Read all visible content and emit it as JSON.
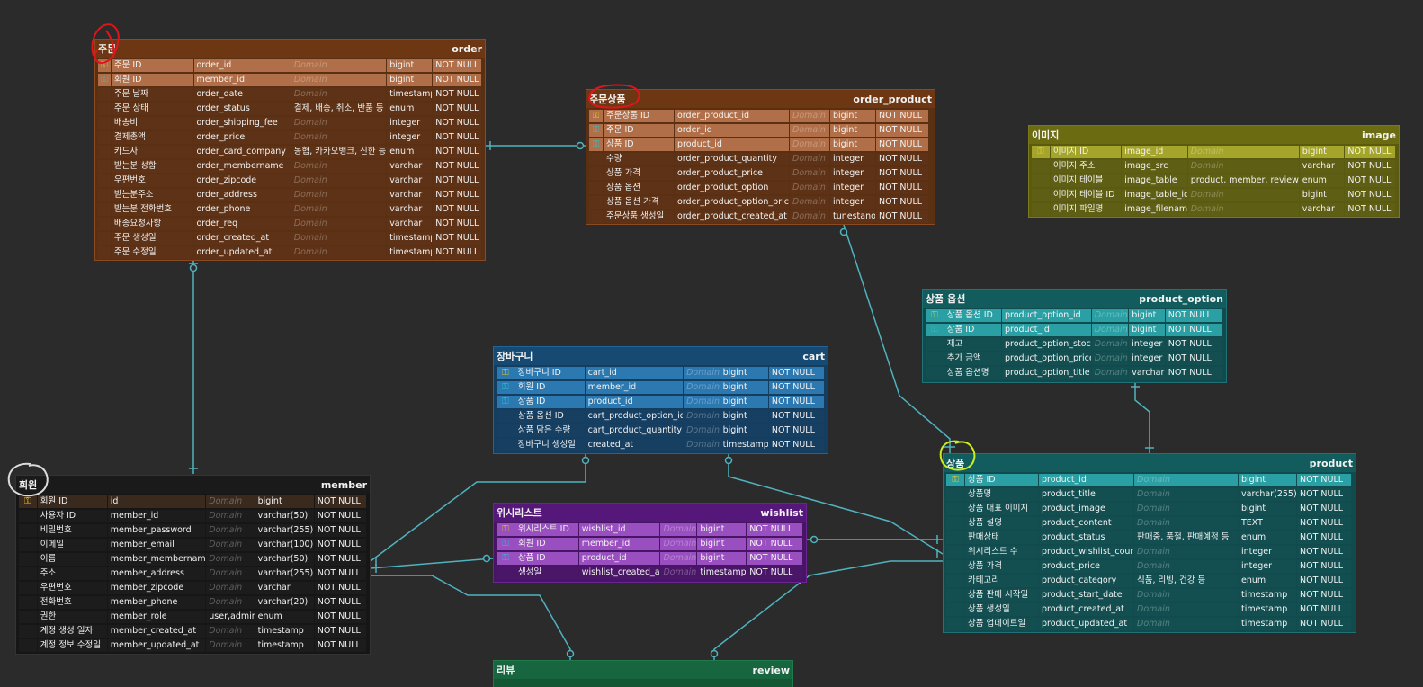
{
  "entities": {
    "order": {
      "korean": "주문",
      "english": "order",
      "colors": {
        "header": "#6d3714",
        "body": "#5b2f12",
        "key": "#b06f48",
        "cell": "#5e3216",
        "border": "#8a4a22"
      },
      "rows": [
        {
          "key": "pk",
          "logical": "주문 ID",
          "physical": "order_id",
          "domain": "Domain",
          "type": "bigint",
          "nn": "NOT NULL"
        },
        {
          "key": "fk",
          "logical": "회원 ID",
          "physical": "member_id",
          "domain": "Domain",
          "type": "bigint",
          "nn": "NOT NULL"
        },
        {
          "key": "",
          "logical": "주문 날짜",
          "physical": "order_date",
          "domain": "Domain",
          "type": "timestamp",
          "nn": "NOT NULL"
        },
        {
          "key": "",
          "logical": "주문 상태",
          "physical": "order_status",
          "domain": "결제, 배송, 취소, 반품 등",
          "type": "enum",
          "nn": "NOT NULL"
        },
        {
          "key": "",
          "logical": "배송비",
          "physical": "order_shipping_fee",
          "domain": "Domain",
          "type": "integer",
          "nn": "NOT NULL"
        },
        {
          "key": "",
          "logical": "결제총액",
          "physical": "order_price",
          "domain": "Domain",
          "type": "integer",
          "nn": "NOT NULL"
        },
        {
          "key": "",
          "logical": "카드사",
          "physical": "order_card_company",
          "domain": "농협, 카카오뱅크, 신한 등",
          "type": "enum",
          "nn": "NOT NULL"
        },
        {
          "key": "",
          "logical": "받는분 성함",
          "physical": "order_membername",
          "domain": "Domain",
          "type": "varchar",
          "nn": "NOT NULL"
        },
        {
          "key": "",
          "logical": "우편번호",
          "physical": "order_zipcode",
          "domain": "Domain",
          "type": "varchar",
          "nn": "NOT NULL"
        },
        {
          "key": "",
          "logical": "받는분주소",
          "physical": "order_address",
          "domain": "Domain",
          "type": "varchar",
          "nn": "NOT NULL"
        },
        {
          "key": "",
          "logical": "받는분 전화번호",
          "physical": "order_phone",
          "domain": "Domain",
          "type": "varchar",
          "nn": "NOT NULL"
        },
        {
          "key": "",
          "logical": "배송요청사항",
          "physical": "order_req",
          "domain": "Domain",
          "type": "varchar",
          "nn": "NOT NULL"
        },
        {
          "key": "",
          "logical": "주문 생성일",
          "physical": "order_created_at",
          "domain": "Domain",
          "type": "timestamp",
          "nn": "NOT NULL"
        },
        {
          "key": "",
          "logical": "주문 수정일",
          "physical": "order_updated_at",
          "domain": "Domain",
          "type": "timestamp",
          "nn": "NOT NULL"
        }
      ]
    },
    "order_product": {
      "korean": "주문상품",
      "english": "order_product",
      "colors": {
        "header": "#6d3714",
        "body": "#5b2f12",
        "key": "#b06f48",
        "cell": "#5e3216",
        "border": "#8a4a22"
      },
      "rows": [
        {
          "key": "pk",
          "logical": "주문상품 ID",
          "physical": "order_product_id",
          "domain": "Domain",
          "type": "bigint",
          "nn": "NOT NULL"
        },
        {
          "key": "fk",
          "logical": "주문 ID",
          "physical": "order_id",
          "domain": "Domain",
          "type": "bigint",
          "nn": "NOT NULL"
        },
        {
          "key": "fk",
          "logical": "상품 ID",
          "physical": "product_id",
          "domain": "Domain",
          "type": "bigint",
          "nn": "NOT NULL"
        },
        {
          "key": "",
          "logical": "수량",
          "physical": "order_product_quantity",
          "domain": "Domain",
          "type": "integer",
          "nn": "NOT NULL"
        },
        {
          "key": "",
          "logical": "상품 가격",
          "physical": "order_product_price",
          "domain": "Domain",
          "type": "integer",
          "nn": "NOT NULL"
        },
        {
          "key": "",
          "logical": "상품 옵션",
          "physical": "order_product_option",
          "domain": "Domain",
          "type": "integer",
          "nn": "NOT NULL"
        },
        {
          "key": "",
          "logical": "상품 옵션 가격",
          "physical": "order_product_option_price",
          "domain": "Domain",
          "type": "integer",
          "nn": "NOT NULL"
        },
        {
          "key": "",
          "logical": "주문상품 생성일",
          "physical": "order_product_created_at",
          "domain": "Domain",
          "type": "tunestano",
          "nn": "NOT NULL"
        }
      ]
    },
    "image": {
      "korean": "이미지",
      "english": "image",
      "colors": {
        "header": "#6b6b12",
        "body": "#5a5a10",
        "key": "#a5a52c",
        "cell": "#5e5e14",
        "border": "#7a7a1a"
      },
      "rows": [
        {
          "key": "pk",
          "logical": "이미지 ID",
          "physical": "image_id",
          "domain": "Domain",
          "type": "bigint",
          "nn": "NOT NULL"
        },
        {
          "key": "",
          "logical": "이미지 주소",
          "physical": "image_src",
          "domain": "Domain",
          "type": "varchar",
          "nn": "NOT NULL"
        },
        {
          "key": "",
          "logical": "이미지 테이블",
          "physical": "image_table",
          "domain": "product, member, review 등",
          "type": "enum",
          "nn": "NOT NULL"
        },
        {
          "key": "",
          "logical": "이미지 테이블 ID",
          "physical": "image_table_id",
          "domain": "Domain",
          "type": "bigint",
          "nn": "NOT NULL"
        },
        {
          "key": "",
          "logical": "이미지 파일명",
          "physical": "image_filename",
          "domain": "Domain",
          "type": "varchar",
          "nn": "NOT NULL"
        }
      ]
    },
    "product_option": {
      "korean": "상품 옵션",
      "english": "product_option",
      "colors": {
        "header": "#135c5e",
        "body": "#114b4d",
        "key": "#2aa0a4",
        "cell": "#134f51",
        "border": "#1f7275"
      },
      "rows": [
        {
          "key": "pk",
          "logical": "상품 옵션 ID",
          "physical": "product_option_id",
          "domain": "Domain",
          "type": "bigint",
          "nn": "NOT NULL"
        },
        {
          "key": "fk",
          "logical": "상품 ID",
          "physical": "product_id",
          "domain": "Domain",
          "type": "bigint",
          "nn": "NOT NULL"
        },
        {
          "key": "",
          "logical": "재고",
          "physical": "product_option_stock",
          "domain": "Domain",
          "type": "integer",
          "nn": "NOT NULL"
        },
        {
          "key": "",
          "logical": "추가 금액",
          "physical": "product_option_price",
          "domain": "Domain",
          "type": "integer",
          "nn": "NOT NULL"
        },
        {
          "key": "",
          "logical": "상품 옵션명",
          "physical": "product_option_title",
          "domain": "Domain",
          "type": "varchar",
          "nn": "NOT NULL"
        }
      ]
    },
    "cart": {
      "korean": "장바구니",
      "english": "cart",
      "colors": {
        "header": "#174a73",
        "body": "#143e60",
        "key": "#2c79b2",
        "cell": "#163f62",
        "border": "#23639a"
      },
      "rows": [
        {
          "key": "pk",
          "logical": "장바구니 ID",
          "physical": "cart_id",
          "domain": "Domain",
          "type": "bigint",
          "nn": "NOT NULL"
        },
        {
          "key": "fk",
          "logical": "회원 ID",
          "physical": "member_id",
          "domain": "Domain",
          "type": "bigint",
          "nn": "NOT NULL"
        },
        {
          "key": "fk",
          "logical": "상품 ID",
          "physical": "product_id",
          "domain": "Domain",
          "type": "bigint",
          "nn": "NOT NULL"
        },
        {
          "key": "",
          "logical": "상품 옵션 ID",
          "physical": "cart_product_option_id",
          "domain": "Domain",
          "type": "bigint",
          "nn": "NOT NULL"
        },
        {
          "key": "",
          "logical": "상품 담은 수량",
          "physical": "cart_product_quantity",
          "domain": "Domain",
          "type": "bigint",
          "nn": "NOT NULL"
        },
        {
          "key": "",
          "logical": "장바구니 생성일",
          "physical": "created_at",
          "domain": "Domain",
          "type": "timestamp",
          "nn": "NOT NULL"
        }
      ]
    },
    "member": {
      "korean": "회원",
      "english": "member",
      "colors": {
        "header": "#1a1a1a",
        "body": "#161616",
        "key": "#3a2a1e",
        "cell": "#1c1c1c",
        "border": "#333333"
      },
      "rows": [
        {
          "key": "pk",
          "logical": "회원 ID",
          "physical": "id",
          "domain": "Domain",
          "type": "bigint",
          "nn": "NOT NULL"
        },
        {
          "key": "",
          "logical": "사용자 ID",
          "physical": "member_id",
          "domain": "Domain",
          "type": "varchar(50)",
          "nn": "NOT NULL"
        },
        {
          "key": "",
          "logical": "비밀번호",
          "physical": "member_password",
          "domain": "Domain",
          "type": "varchar(255)",
          "nn": "NOT NULL"
        },
        {
          "key": "",
          "logical": "이메일",
          "physical": "member_email",
          "domain": "Domain",
          "type": "varchar(100)",
          "nn": "NOT NULL"
        },
        {
          "key": "",
          "logical": "이름",
          "physical": "member_membername",
          "domain": "Domain",
          "type": "varchar(50)",
          "nn": "NOT NULL"
        },
        {
          "key": "",
          "logical": "주소",
          "physical": "member_address",
          "domain": "Domain",
          "type": "varchar(255)",
          "nn": "NOT NULL"
        },
        {
          "key": "",
          "logical": "우편번호",
          "physical": "member_zipcode",
          "domain": "Domain",
          "type": "varchar",
          "nn": "NOT NULL"
        },
        {
          "key": "",
          "logical": "전화번호",
          "physical": "member_phone",
          "domain": "Domain",
          "type": "varchar(20)",
          "nn": "NOT NULL"
        },
        {
          "key": "",
          "logical": "권한",
          "physical": "member_role",
          "domain": "user,admin",
          "type": "enum",
          "nn": "NOT NULL"
        },
        {
          "key": "",
          "logical": "계정 생성 일자",
          "physical": "member_created_at",
          "domain": "Domain",
          "type": "timestamp",
          "nn": "NOT NULL"
        },
        {
          "key": "",
          "logical": "계정 정보 수정일",
          "physical": "member_updated_at",
          "domain": "Domain",
          "type": "timestamp",
          "nn": "NOT NULL"
        }
      ]
    },
    "wishlist": {
      "korean": "위시리스트",
      "english": "wishlist",
      "colors": {
        "header": "#56177a",
        "body": "#471466",
        "key": "#9a4fc0",
        "cell": "#4a1668",
        "border": "#6b2494"
      },
      "rows": [
        {
          "key": "pk",
          "logical": "위시리스트 ID",
          "physical": "wishlist_id",
          "domain": "Domain",
          "type": "bigint",
          "nn": "NOT NULL"
        },
        {
          "key": "fk",
          "logical": "회원 ID",
          "physical": "member_id",
          "domain": "Domain",
          "type": "bigint",
          "nn": "NOT NULL"
        },
        {
          "key": "fk",
          "logical": "상품 ID",
          "physical": "product_id",
          "domain": "Domain",
          "type": "bigint",
          "nn": "NOT NULL"
        },
        {
          "key": "",
          "logical": "생성일",
          "physical": "wishlist_created_at",
          "domain": "Domain",
          "type": "timestamp",
          "nn": "NOT NULL"
        }
      ]
    },
    "product": {
      "korean": "상품",
      "english": "product",
      "colors": {
        "header": "#135c5e",
        "body": "#114b4d",
        "key": "#2aa0a4",
        "cell": "#134f51",
        "border": "#1f7275"
      },
      "rows": [
        {
          "key": "pk",
          "logical": "상품 ID",
          "physical": "product_id",
          "domain": "Domain",
          "type": "bigint",
          "nn": "NOT NULL"
        },
        {
          "key": "",
          "logical": "상품명",
          "physical": "product_title",
          "domain": "Domain",
          "type": "varchar(255)",
          "nn": "NOT NULL"
        },
        {
          "key": "",
          "logical": "상품 대표 이미지",
          "physical": "product_image",
          "domain": "Domain",
          "type": "bigint",
          "nn": "NOT NULL"
        },
        {
          "key": "",
          "logical": "상품 설명",
          "physical": "product_content",
          "domain": "Domain",
          "type": "TEXT",
          "nn": "NOT NULL"
        },
        {
          "key": "",
          "logical": "판매상태",
          "physical": "product_status",
          "domain": "판매중, 품절, 판매예정 등",
          "type": "enum",
          "nn": "NOT NULL"
        },
        {
          "key": "",
          "logical": "위시리스트 수",
          "physical": "product_wishlist_count",
          "domain": "Domain",
          "type": "integer",
          "nn": "NOT NULL"
        },
        {
          "key": "",
          "logical": "상품 가격",
          "physical": "product_price",
          "domain": "Domain",
          "type": "integer",
          "nn": "NOT NULL"
        },
        {
          "key": "",
          "logical": "카테고리",
          "physical": "product_category",
          "domain": "식품, 리빙, 건강 등",
          "type": "enum",
          "nn": "NOT NULL"
        },
        {
          "key": "",
          "logical": "상품 판매 시작일",
          "physical": "product_start_date",
          "domain": "Domain",
          "type": "timestamp",
          "nn": "NOT NULL"
        },
        {
          "key": "",
          "logical": "상품 생성일",
          "physical": "product_created_at",
          "domain": "Domain",
          "type": "timestamp",
          "nn": "NOT NULL"
        },
        {
          "key": "",
          "logical": "상품 업데이트일",
          "physical": "product_updated_at",
          "domain": "Domain",
          "type": "timestamp",
          "nn": "NOT NULL"
        }
      ]
    },
    "review": {
      "korean": "리뷰",
      "english": "review",
      "colors": {
        "header": "#17663f",
        "body": "#145735",
        "key": "#2f9a66",
        "cell": "#155a37",
        "border": "#1f7a4b"
      },
      "rows": []
    }
  },
  "annotations": {
    "red": "#e0141b",
    "white": "#dcdcdc",
    "yellow": "#c8ee22"
  },
  "connector_color": "#4fb3bf",
  "key_icons": {
    "pk": "key-icon",
    "fk": "foreign-key-icon"
  }
}
